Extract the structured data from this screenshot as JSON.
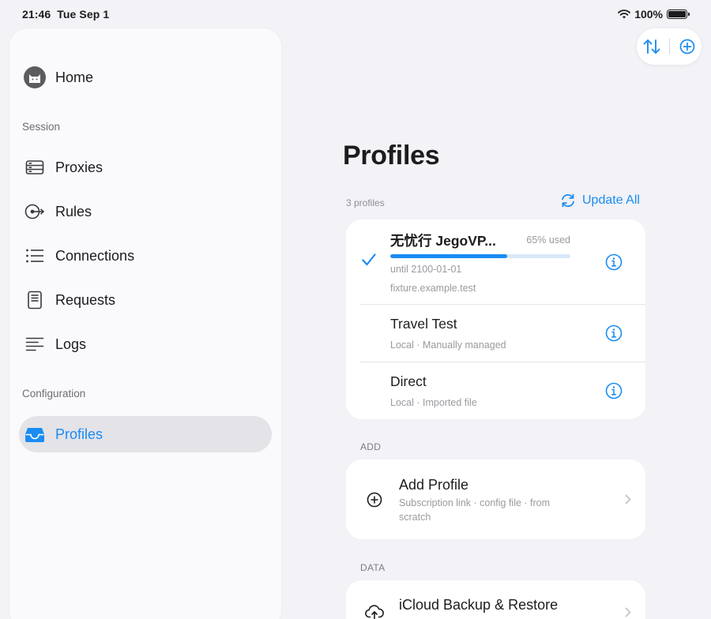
{
  "status": {
    "time": "21:46",
    "date": "Tue Sep 1",
    "battery": "100%"
  },
  "sidebar": {
    "home": "Home",
    "section_session": "Session",
    "items": [
      {
        "label": "Proxies",
        "icon": "server-icon"
      },
      {
        "label": "Rules",
        "icon": "route-icon"
      },
      {
        "label": "Connections",
        "icon": "list-icon"
      },
      {
        "label": "Requests",
        "icon": "document-icon"
      },
      {
        "label": "Logs",
        "icon": "text-lines-icon"
      }
    ],
    "section_configuration": "Configuration",
    "profiles": "Profiles"
  },
  "main": {
    "title": "Profiles",
    "count": "3 profiles",
    "update_all": "Update All",
    "profiles": [
      {
        "name": "无忧行 JegoVP...",
        "usage": "65% used",
        "usage_fraction": 0.65,
        "until": "until 2100-01-01",
        "host": "fixture.example.test",
        "selected": true
      },
      {
        "name": "Travel Test",
        "sub": "Local · Manually managed"
      },
      {
        "name": "Direct",
        "sub": "Local · Imported file"
      }
    ],
    "add_label": "ADD",
    "add_profile": {
      "title": "Add Profile",
      "sub": "Subscription link · config file · from scratch"
    },
    "data_label": "DATA",
    "icloud": {
      "title": "iCloud Backup & Restore"
    }
  },
  "colors": {
    "accent": "#1a8cf2",
    "background": "#f2f2f7"
  }
}
